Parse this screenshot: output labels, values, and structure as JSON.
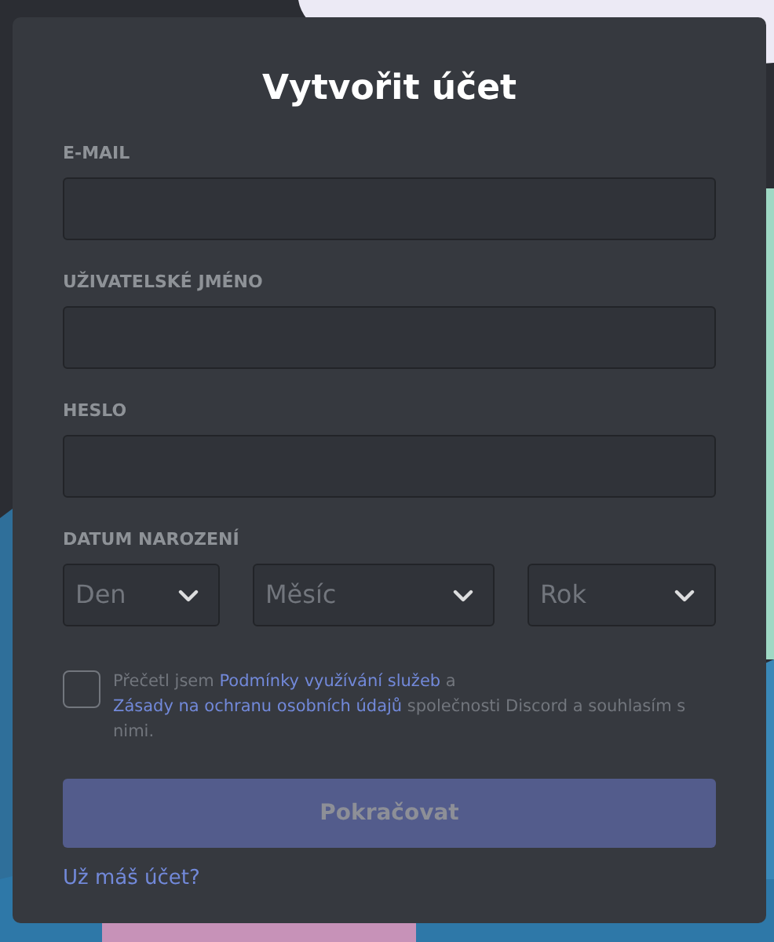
{
  "title": "Vytvořit účet",
  "fields": [
    {
      "label": "E-MAIL"
    },
    {
      "label": "UŽIVATELSKÉ JMÉNO"
    },
    {
      "label": "HESLO"
    }
  ],
  "birthdate": {
    "label": "DATUM NAROZENÍ",
    "selects": [
      {
        "placeholder": "Den"
      },
      {
        "placeholder": "Měsíc"
      },
      {
        "placeholder": "Rok"
      }
    ]
  },
  "consent": {
    "checked": false,
    "parts": [
      {
        "kind": "text",
        "text": "Přečetl jsem"
      },
      {
        "kind": "link",
        "text": "Podmínky využívání služeb"
      },
      {
        "kind": "text",
        "text": "a"
      },
      {
        "kind": "link",
        "text": "Zásady na ochranu osobních údajů"
      },
      {
        "kind": "text",
        "text": "společnosti Discord a souhlasím s nimi."
      }
    ]
  },
  "submit": {
    "label": "Pokračovat",
    "disabled": true
  },
  "login_link": "Už máš účet?"
}
